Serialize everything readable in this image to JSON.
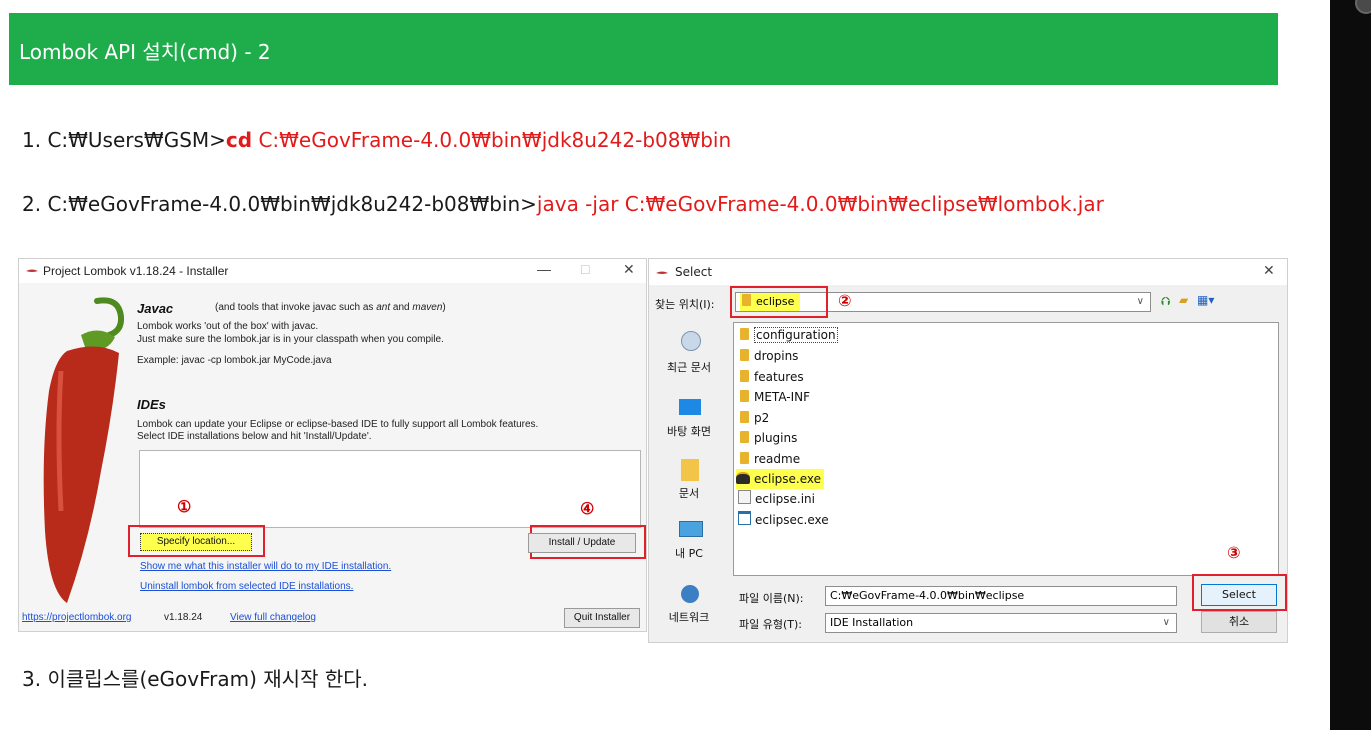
{
  "banner": {
    "title": "Lombok API 설치(cmd) - 2",
    "color": "#1fad4b"
  },
  "steps": {
    "s1_prefix": "1. C:₩Users₩GSM>",
    "s1_cmd": "cd",
    "s1_path": "C:₩eGovFrame-4.0.0₩bin₩jdk8u242-b08₩bin",
    "s2_prefix": "2. C:₩eGovFrame-4.0.0₩bin₩jdk8u242-b08₩bin>",
    "s2_cmd": "java -jar C:₩eGovFrame-4.0.0₩bin₩eclipse₩lombok.jar",
    "s3": "3. 이클립스를(eGovFram) 재시작 한다."
  },
  "installer": {
    "title": "Project Lombok v1.18.24 - Installer",
    "javac_heading": "Javac",
    "javac_note_pre": "(and tools that invoke javac such as ",
    "javac_note_ant": "ant",
    "javac_note_mid": " and ",
    "javac_note_maven": "maven",
    "javac_note_post": ")",
    "javac_line1": "Lombok works 'out of the box' with javac.",
    "javac_line2": "Just make sure the lombok.jar is in your classpath when you compile.",
    "javac_example": "Example: javac -cp lombok.jar MyCode.java",
    "ides_heading": "IDEs",
    "ides_line1": "Lombok can update your Eclipse or eclipse-based IDE to fully support all Lombok features.",
    "ides_line2": "Select IDE installations below and hit 'Install/Update'.",
    "specify_location": "Specify location...",
    "install_update": "Install / Update",
    "show_me": "Show me what this installer will do to my IDE installation.",
    "uninstall": "Uninstall lombok from selected IDE installations.",
    "site_link": "https://projectlombok.org",
    "version": "v1.18.24",
    "changelog": "View full changelog",
    "quit": "Quit Installer",
    "marker1": "①",
    "marker4": "④"
  },
  "select_dialog": {
    "title": "Select",
    "look_in_label": "찾는 위치(I):",
    "look_in_value": "eclipse",
    "places": [
      "최근 문서",
      "바탕 화면",
      "문서",
      "내 PC",
      "네트워크"
    ],
    "files": [
      "configuration",
      "dropins",
      "features",
      "META-INF",
      "p2",
      "plugins",
      "readme",
      "eclipse.exe",
      "eclipse.ini",
      "eclipsec.exe"
    ],
    "filename_label": "파일 이름(N):",
    "filename_value": "C:₩eGovFrame-4.0.0₩bin₩eclipse",
    "filetype_label": "파일 유형(T):",
    "filetype_value": "IDE Installation",
    "select_btn": "Select",
    "cancel_btn": "취소",
    "marker2": "②",
    "marker3": "③"
  },
  "colors": {
    "highlight": "#ffff4d",
    "annotation": "#e0202a"
  }
}
